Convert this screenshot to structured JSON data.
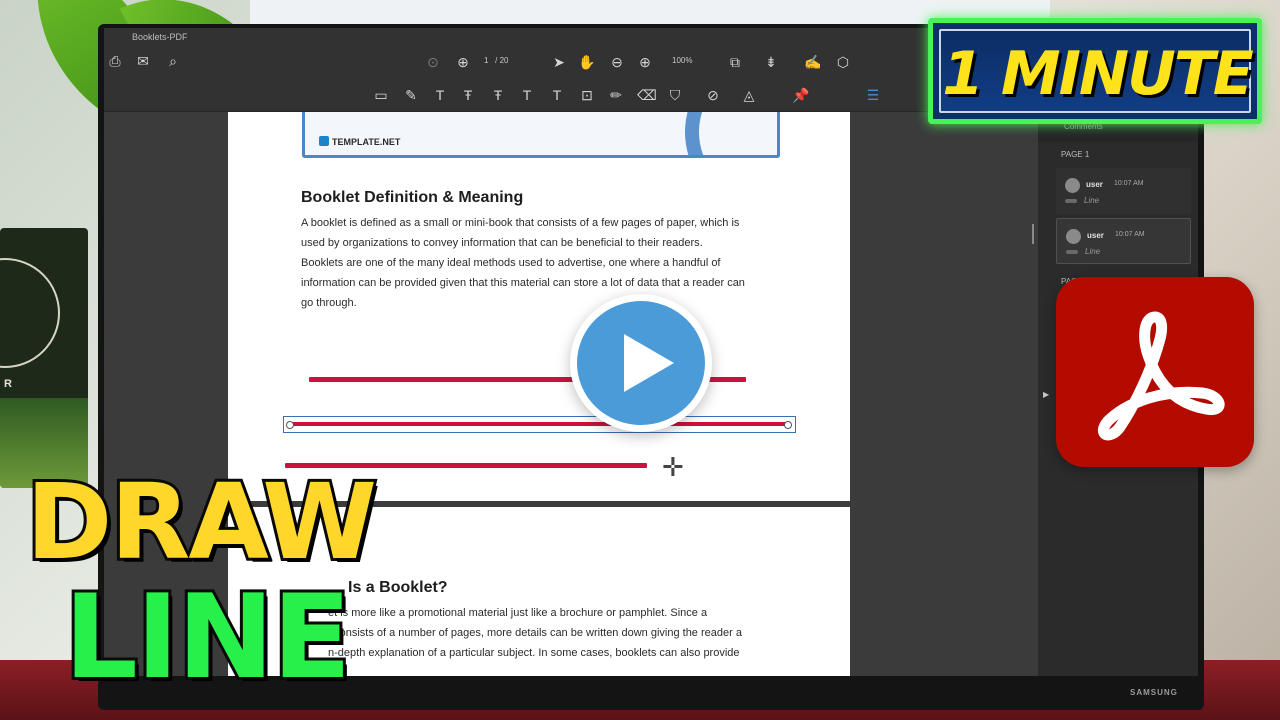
{
  "app": {
    "window_title": "Booklets-PDF"
  },
  "toolbar": {
    "page_current": "1",
    "page_total": "/ 20",
    "zoom": "100%",
    "annotation_color": "#d51a1a",
    "font_button": "Aa"
  },
  "document": {
    "logo_text": "TEMPLATE.NET",
    "heading": "Booklet Definition & Meaning",
    "paragraph": [
      "A booklet is defined as a small or mini-book that consists of a few pages of paper, which is",
      "used by organizations to convey information that can be beneficial to their readers.",
      "Booklets are one of the many ideal methods used to advertise, one where a handful of",
      "information can be provided given that this material can store a lot of data that a reader can",
      "go through."
    ],
    "heading2": "Is a Booklet?",
    "paragraph2": [
      "et is more like a promotional material just like a brochure or pamphlet. Since a",
      "t consists of a number of pages, more details can be written down giving the reader a",
      "n-depth explanation of a particular subject. In some cases, booklets can also provide"
    ],
    "line_color": "#c8133f"
  },
  "comments_panel": {
    "header": "Comments",
    "page_label": "PAGE 1",
    "page_label_2": "PAGE",
    "items": [
      {
        "user": "user",
        "time": "10:07 AM",
        "kind": "Line"
      },
      {
        "user": "user",
        "time": "10:07 AM",
        "kind": "Line"
      }
    ]
  },
  "overlay": {
    "badge": "1 MINUTE",
    "title_line1": "DRAW",
    "title_line2": "LINE",
    "monitor_brand": "SAMSUNG",
    "calendar_text": "R",
    "badge_color": "#ffe31a",
    "title_color1": "#ffd72a",
    "title_color2": "#28f04a"
  }
}
